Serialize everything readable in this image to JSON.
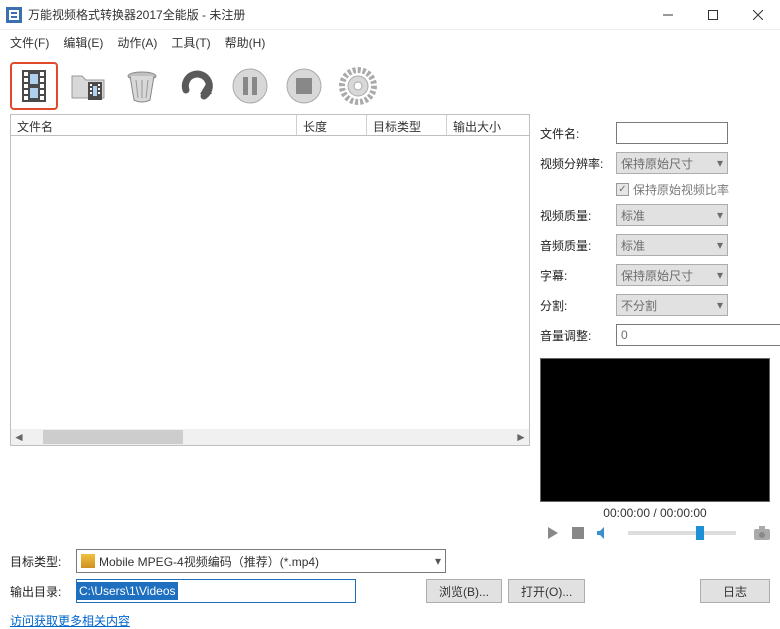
{
  "window": {
    "title": "万能视频格式转换器2017全能版 - 未注册"
  },
  "menu": {
    "file": "文件(F)",
    "edit": "编辑(E)",
    "action": "动作(A)",
    "tools": "工具(T)",
    "help": "帮助(H)"
  },
  "list": {
    "cols": {
      "name": "文件名",
      "length": "长度",
      "target": "目标类型",
      "size": "输出大小"
    }
  },
  "props": {
    "filename_label": "文件名:",
    "resolution_label": "视频分辨率:",
    "resolution_value": "保持原始尺寸",
    "keep_ratio": "保持原始视频比率",
    "vquality_label": "视频质量:",
    "vquality_value": "标准",
    "aquality_label": "音频质量:",
    "aquality_value": "标准",
    "subtitle_label": "字幕:",
    "subtitle_value": "保持原始尺寸",
    "split_label": "分割:",
    "split_value": "不分割",
    "volume_label": "音量调整:",
    "volume_value": "0"
  },
  "time": "00:00:00 / 00:00:00",
  "bottom": {
    "target_label": "目标类型:",
    "target_value": "Mobile MPEG-4视频编码（推荐）(*.mp4)",
    "outdir_label": "输出目录:",
    "outdir_value": "C:\\Users\\1\\Videos",
    "browse": "浏览(B)...",
    "open": "打开(O)...",
    "log": "日志",
    "link": "访问获取更多相关内容"
  }
}
